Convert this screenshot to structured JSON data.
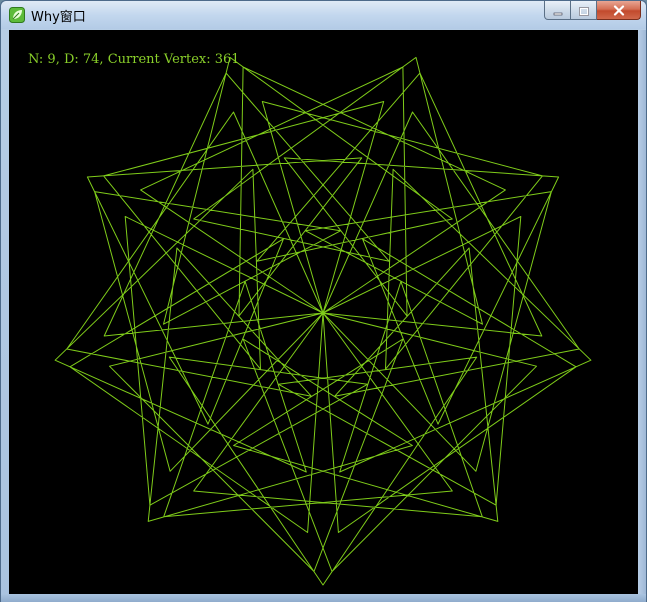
{
  "window": {
    "title": "Why窗口",
    "icon": "leaf-app-icon",
    "buttons": {
      "minimize_icon": "minimize-icon",
      "maximize_icon": "maximize-icon",
      "close_icon": "close-icon"
    }
  },
  "canvas": {
    "background": "#000000",
    "stroke_color": "#7fcc1a",
    "info_text": "N: 9, D: 74, Current Vertex: 361",
    "n": 9,
    "d": 74,
    "current_vertex": 361
  },
  "colors": {
    "line": "#7fcc1a",
    "info_text": "#8ad02a"
  }
}
